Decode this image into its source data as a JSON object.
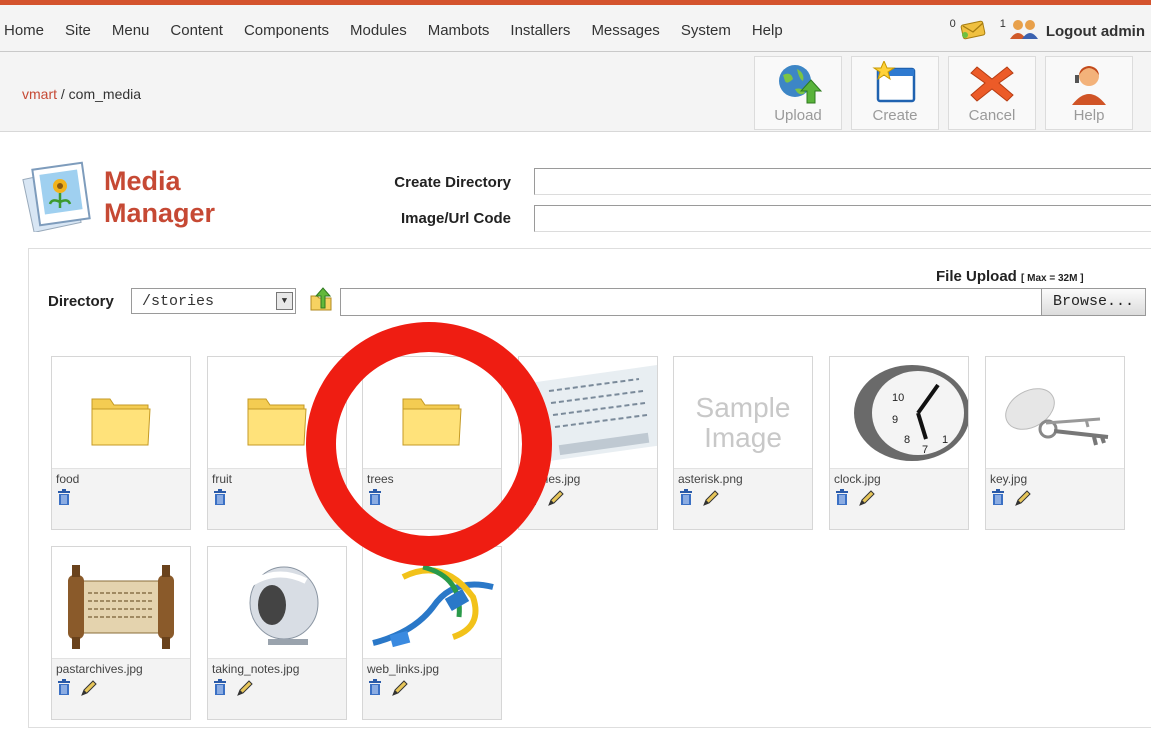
{
  "menu": [
    "Home",
    "Site",
    "Menu",
    "Content",
    "Components",
    "Modules",
    "Mambots",
    "Installers",
    "Messages",
    "System",
    "Help"
  ],
  "status": {
    "messages_count": "0",
    "users_count": "1",
    "logout_label": "Logout admin"
  },
  "breadcrumb": {
    "link": "vmart",
    "separator": " / ",
    "current": "com_media"
  },
  "toolbar": {
    "upload": "Upload",
    "create": "Create",
    "cancel": "Cancel",
    "help": "Help"
  },
  "manager": {
    "title_line1": "Media",
    "title_line2": "Manager",
    "create_directory_label": "Create Directory",
    "image_url_label": "Image/Url Code",
    "directory_label": "Directory",
    "directory_value": "/stories",
    "file_upload_label": "File Upload",
    "file_upload_max": "[ Max = 32M ]",
    "browse_label": "Browse..."
  },
  "items": [
    {
      "name": "food",
      "type": "folder"
    },
    {
      "name": "fruit",
      "type": "folder"
    },
    {
      "name": "trees",
      "type": "folder"
    },
    {
      "name": "articles.jpg",
      "type": "image",
      "thumb": "articles-icon"
    },
    {
      "name": "asterisk.png",
      "type": "image",
      "thumb": "sample-image",
      "sample_text": [
        "Sample",
        "Image"
      ]
    },
    {
      "name": "clock.jpg",
      "type": "image",
      "thumb": "clock-icon"
    },
    {
      "name": "key.jpg",
      "type": "image",
      "thumb": "key-icon"
    },
    {
      "name": "pastarchives.jpg",
      "type": "image",
      "thumb": "scroll-icon"
    },
    {
      "name": "taking_notes.jpg",
      "type": "image",
      "thumb": "notes-icon"
    },
    {
      "name": "web_links.jpg",
      "type": "image",
      "thumb": "cables-icon"
    }
  ],
  "colors": {
    "accent": "#c64934",
    "highlight_ring": "#ef1d12",
    "top_border": "#d4532d"
  }
}
